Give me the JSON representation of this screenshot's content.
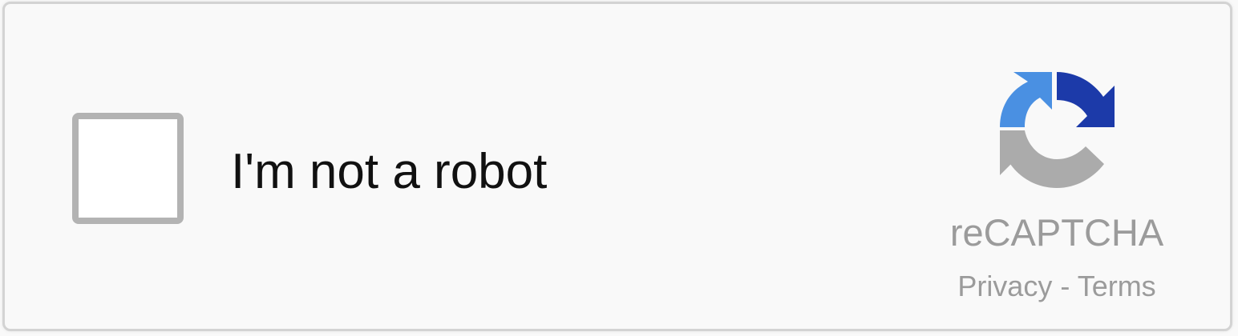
{
  "captcha": {
    "checkbox_label": "I'm not a robot",
    "checked": false,
    "brand_name": "reCAPTCHA",
    "privacy_link": "Privacy",
    "separator": " - ",
    "terms_link": "Terms",
    "logo_icon": "recaptcha-logo-icon",
    "colors": {
      "border": "#d3d3d3",
      "background": "#f9f9f9",
      "checkbox_border": "#b3b3b3",
      "text": "#111111",
      "muted_text": "#9b9b9b",
      "logo_light_blue": "#4a90e2",
      "logo_dark_blue": "#1c3aa9",
      "logo_gray": "#ababab"
    }
  }
}
